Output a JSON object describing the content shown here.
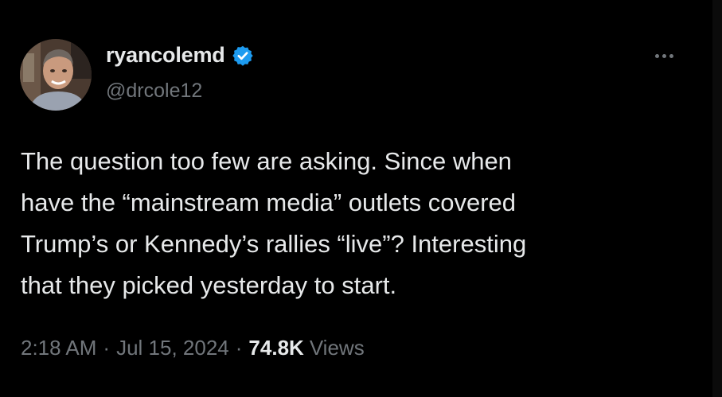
{
  "tweet": {
    "author": {
      "display_name": "ryancolemd",
      "handle": "@drcole12",
      "verified": true,
      "verified_color": "#1d9bf0"
    },
    "more_icon": "more-horizontal-icon",
    "text": "The question too few are asking. Since when\nhave the “mainstream media” outlets covered\nTrump’s or Kennedy’s rallies “live”? Interesting\nthat they picked yesterday to start.",
    "time": "2:18 AM",
    "separator": "·",
    "date": "Jul 15, 2024",
    "views_count": "74.8K",
    "views_label": "Views"
  },
  "colors": {
    "background": "#000000",
    "primary_text": "#e7e9ea",
    "secondary_text": "#71767b"
  }
}
